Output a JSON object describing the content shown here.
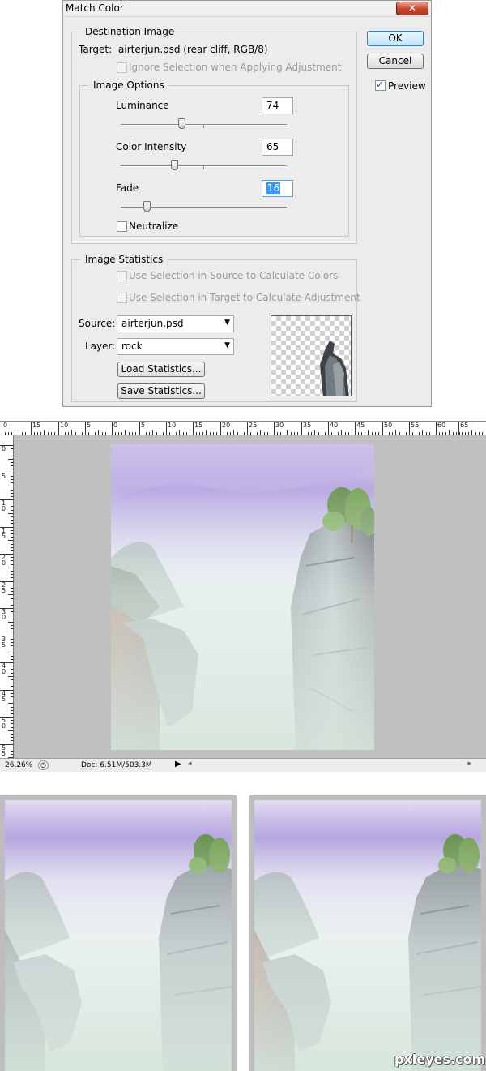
{
  "dialog": {
    "title": "Match Color",
    "close_label": "✕",
    "destination": {
      "group_title": "Destination Image",
      "target_label": "Target:",
      "target_value": "airterjun.psd (rear cliff, RGB/8)",
      "ignore_selection_label": "Ignore Selection when Applying Adjustment",
      "ignore_selection_checked": false
    },
    "image_options": {
      "group_title": "Image Options",
      "luminance_label": "Luminance",
      "luminance_value": "74",
      "luminance_fraction": 0.37,
      "color_intensity_label": "Color Intensity",
      "color_intensity_value": "65",
      "color_intensity_fraction": 0.325,
      "fade_label": "Fade",
      "fade_value": "16",
      "fade_fraction": 0.16,
      "neutralize_label": "Neutralize",
      "neutralize_checked": false
    },
    "buttons": {
      "ok_label": "OK",
      "cancel_label": "Cancel",
      "preview_label": "Preview",
      "preview_checked": true
    },
    "statistics": {
      "group_title": "Image Statistics",
      "use_sel_source_label": "Use Selection in Source to Calculate Colors",
      "use_sel_target_label": "Use Selection in Target to Calculate Adjustment",
      "source_label": "Source:",
      "source_value": "airterjun.psd",
      "layer_label": "Layer:",
      "layer_value": "rock",
      "load_label": "Load Statistics...",
      "save_label": "Save Statistics..."
    }
  },
  "canvas": {
    "ruler_h_labels": [
      "0",
      "15",
      "10",
      "5",
      "0",
      "5",
      "10",
      "15",
      "20",
      "25",
      "30",
      "35",
      "40",
      "45",
      "50",
      "55",
      "60",
      "65"
    ],
    "ruler_v_labels": [
      "0",
      "5",
      "10",
      "15",
      "20",
      "25",
      "30",
      "35",
      "40",
      "45",
      "50",
      "55"
    ],
    "zoom": "26.26%",
    "doc_info": "Doc: 6.51M/503.3M"
  },
  "watermark": "pxleyes.com",
  "colors": {
    "sky": "#9a8ad6",
    "mist": "#d9e6e0",
    "rock_grey": "#6f7880",
    "rock_brown": "#6a3a2c",
    "tree_green": "#5f8d3a"
  }
}
